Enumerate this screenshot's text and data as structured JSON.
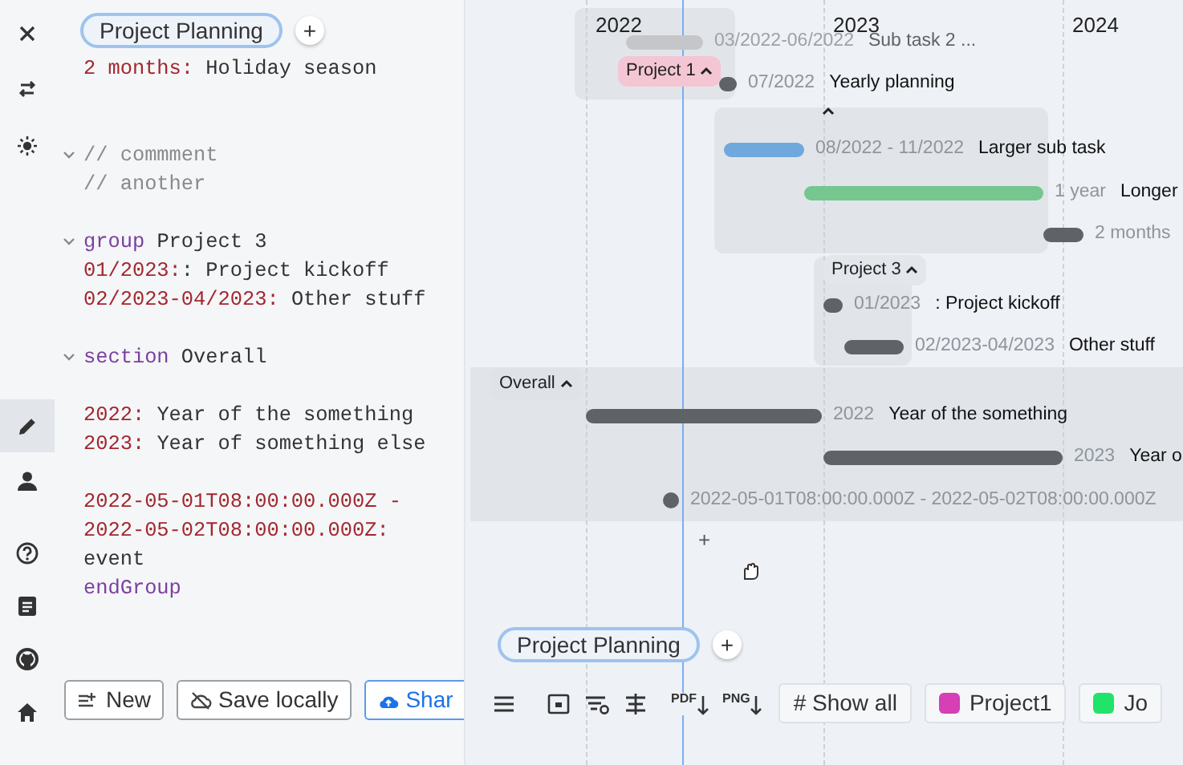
{
  "rail": [
    {
      "kind": "close",
      "selected": false
    },
    {
      "kind": "swap",
      "selected": false
    },
    {
      "kind": "sun",
      "selected": false
    },
    {
      "kind": "pencil",
      "selected": true
    },
    {
      "kind": "person",
      "selected": false
    },
    {
      "kind": "help",
      "selected": false
    },
    {
      "kind": "document",
      "selected": false
    },
    {
      "kind": "cat",
      "selected": false
    },
    {
      "kind": "home",
      "selected": false
    }
  ],
  "editor": {
    "tab": "Project Planning",
    "add": "+",
    "lines": [
      {
        "kind": "code",
        "foldable": false,
        "tokens": [
          {
            "kind": "key",
            "text": "2 months:"
          },
          {
            "kind": "text",
            "text": " Holiday season"
          }
        ]
      },
      {
        "kind": "blank"
      },
      {
        "kind": "blank"
      },
      {
        "kind": "code",
        "foldable": true,
        "tokens": [
          {
            "kind": "comment",
            "text": "// commment"
          }
        ]
      },
      {
        "kind": "code",
        "foldable": false,
        "tokens": [
          {
            "kind": "comment",
            "text": "// another"
          }
        ]
      },
      {
        "kind": "blank"
      },
      {
        "kind": "code",
        "foldable": true,
        "tokens": [
          {
            "kind": "keyword",
            "text": "group"
          },
          {
            "kind": "text",
            "text": " Project 3"
          }
        ]
      },
      {
        "kind": "code",
        "foldable": false,
        "tokens": [
          {
            "kind": "key",
            "text": "01/2023:"
          },
          {
            "kind": "text",
            "text": ": Project kickoff"
          }
        ]
      },
      {
        "kind": "code",
        "foldable": false,
        "tokens": [
          {
            "kind": "key",
            "text": "02/2023-04/2023:"
          },
          {
            "kind": "text",
            "text": " Other stuff"
          }
        ]
      },
      {
        "kind": "blank"
      },
      {
        "kind": "code",
        "foldable": true,
        "tokens": [
          {
            "kind": "keyword",
            "text": "section"
          },
          {
            "kind": "text",
            "text": " Overall"
          }
        ]
      },
      {
        "kind": "blank"
      },
      {
        "kind": "code",
        "foldable": false,
        "tokens": [
          {
            "kind": "key",
            "text": "2022:"
          },
          {
            "kind": "text",
            "text": " Year of the something"
          }
        ]
      },
      {
        "kind": "code",
        "foldable": false,
        "tokens": [
          {
            "kind": "key",
            "text": "2023:"
          },
          {
            "kind": "text",
            "text": " Year of something else"
          }
        ]
      },
      {
        "kind": "blank"
      },
      {
        "kind": "code",
        "foldable": false,
        "tokens": [
          {
            "kind": "key",
            "text": "2022-05-01T08:00:00.000Z -"
          }
        ]
      },
      {
        "kind": "code",
        "foldable": false,
        "tokens": [
          {
            "kind": "key",
            "text": "2022-05-02T08:00:00.000Z:"
          }
        ]
      },
      {
        "kind": "code",
        "foldable": false,
        "tokens": [
          {
            "kind": "text",
            "text": "event"
          }
        ]
      },
      {
        "kind": "code",
        "foldable": false,
        "tokens": [
          {
            "kind": "keyword",
            "text": "endGroup"
          }
        ]
      }
    ],
    "buttons": [
      {
        "kind": "new",
        "label": "New",
        "primary": false
      },
      {
        "kind": "save",
        "label": "Save locally",
        "primary": false
      },
      {
        "kind": "share",
        "label": "Shar",
        "primary": true
      }
    ]
  },
  "gantt": {
    "years": [
      {
        "label": "2022"
      },
      {
        "label": "2023"
      },
      {
        "label": "2024"
      }
    ],
    "groups": [
      {
        "kind": "group",
        "label": "Project 1",
        "color": "#f4c6d4"
      },
      {
        "kind": "group"
      },
      {
        "kind": "group",
        "label": "Project 3",
        "color": "#e3e6ea"
      },
      {
        "kind": "section",
        "label": "Overall",
        "color": "#dfe2e6"
      }
    ],
    "tasks": [
      {
        "kind": "bar",
        "color": "#c4c6c9",
        "dimmed": true,
        "date": "03/2022-06/2022",
        "title": "Sub task 2 ..."
      },
      {
        "kind": "milestone",
        "color": "#5f6368",
        "dimmed": false,
        "date": "07/2022",
        "title": "Yearly planning"
      },
      {
        "kind": "bar",
        "color": "#6fa8dc",
        "dimmed": false,
        "date": "08/2022 - 11/2022",
        "title": "Larger sub task"
      },
      {
        "kind": "bar",
        "color": "#76c68f",
        "dimmed": false,
        "date": "1 year",
        "title": "Longer"
      },
      {
        "kind": "bar",
        "color": "#5f6368",
        "dimmed": false,
        "date": "2 months"
      },
      {
        "kind": "milestone",
        "color": "#5f6368",
        "dimmed": false,
        "date": "01/2023",
        "title": ": Project kickoff"
      },
      {
        "kind": "bar",
        "color": "#5f6368",
        "dimmed": false,
        "date": "02/2023-04/2023",
        "title": "Other stuff"
      },
      {
        "kind": "bar",
        "color": "#5f6368",
        "dimmed": false,
        "date": "2022",
        "title": "Year of the something"
      },
      {
        "kind": "bar",
        "color": "#5f6368",
        "dimmed": false,
        "date": "2023",
        "title": "Year o"
      },
      {
        "kind": "dot",
        "color": "#5f6368",
        "dimmed": false,
        "date": "2022-05-01T08:00:00.000Z - 2022-05-02T08:00:00.000Z"
      }
    ],
    "add": "+",
    "tab": "Project Planning",
    "tab_add": "+",
    "tools": [
      {
        "kind": "menu"
      },
      {
        "kind": "frame"
      },
      {
        "kind": "filter"
      },
      {
        "kind": "align"
      }
    ],
    "exports": [
      {
        "label": "PDF"
      },
      {
        "label": "PNG"
      }
    ],
    "tags": [
      {
        "label": "# Show all"
      },
      {
        "label": "Project1",
        "color": "#d63fb5"
      },
      {
        "label": "Jo",
        "color": "#22e36a"
      }
    ]
  }
}
